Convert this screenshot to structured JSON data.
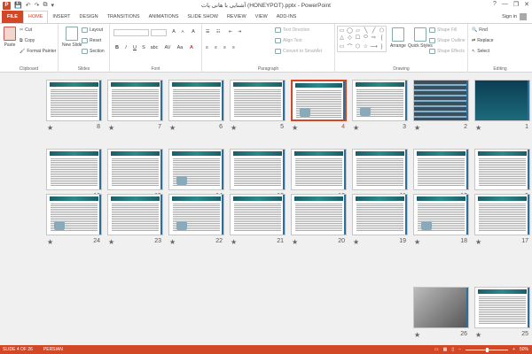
{
  "window": {
    "app_icon": "P",
    "title": "آشنایی با هانی پات (HONEYPOT).pptx - PowerPoint",
    "help": "?",
    "minimize": "—",
    "restore": "❐",
    "close": "✕"
  },
  "qat": {
    "save": "💾",
    "undo": "↶",
    "redo": "↷",
    "start": "⧉",
    "more": "▾"
  },
  "tabs": [
    "FILE",
    "HOME",
    "INSERT",
    "DESIGN",
    "TRANSITIONS",
    "ANIMATIONS",
    "SLIDE SHOW",
    "REVIEW",
    "VIEW",
    "ADD-INS"
  ],
  "active_tab": "HOME",
  "signin": "Sign in",
  "ribbon": {
    "clipboard": {
      "label": "Clipboard",
      "paste": "Paste",
      "cut": "Cut",
      "copy": "Copy",
      "format_painter": "Format Painter"
    },
    "slides": {
      "label": "Slides",
      "new_slide": "New Slide",
      "layout": "Layout",
      "reset": "Reset",
      "section": "Section"
    },
    "font": {
      "label": "Font",
      "size_value": "",
      "grow": "A",
      "shrink": "A",
      "clear": "A",
      "bold": "B",
      "italic": "I",
      "underline": "U",
      "strike": "S",
      "shadow": "abc",
      "spacing": "AV",
      "case": "Aa",
      "color": "A"
    },
    "paragraph": {
      "label": "Paragraph",
      "text_direction": "Text Direction",
      "align_text": "Align Text",
      "convert_smartart": "Convert to SmartArt"
    },
    "drawing": {
      "label": "Drawing",
      "arrange": "Arrange",
      "quick_styles": "Quick Styles",
      "shape_fill": "Shape Fill",
      "shape_outline": "Shape Outline",
      "shape_effects": "Shape Effects",
      "shapes": [
        "▭",
        "◯",
        "▱",
        "╲",
        "╱",
        "⬠",
        "△",
        "◇",
        "☐",
        "⬭",
        "⇨",
        "{",
        "▭",
        "⌒",
        "⬡",
        "☆",
        "⟶",
        "}"
      ]
    },
    "editing": {
      "label": "Editing",
      "find": "Find",
      "replace": "Replace",
      "select": "Select"
    }
  },
  "slides": [
    {
      "num": "1",
      "style": "title-slide"
    },
    {
      "num": "2",
      "style": "screens"
    },
    {
      "num": "3",
      "style": "text-pics"
    },
    {
      "num": "4",
      "style": "text-pics"
    },
    {
      "num": "5",
      "style": "text"
    },
    {
      "num": "6",
      "style": "text"
    },
    {
      "num": "7",
      "style": "text"
    },
    {
      "num": "8",
      "style": "text"
    },
    {
      "num": "9",
      "style": "text"
    },
    {
      "num": "10",
      "style": "text"
    },
    {
      "num": "11",
      "style": "text"
    },
    {
      "num": "12",
      "style": "text"
    },
    {
      "num": "13",
      "style": "text"
    },
    {
      "num": "14",
      "style": "text-pics"
    },
    {
      "num": "15",
      "style": "text"
    },
    {
      "num": "16",
      "style": "text"
    },
    {
      "num": "17",
      "style": "text"
    },
    {
      "num": "18",
      "style": "text-pics"
    },
    {
      "num": "19",
      "style": "text"
    },
    {
      "num": "20",
      "style": "text"
    },
    {
      "num": "21",
      "style": "text"
    },
    {
      "num": "22",
      "style": "text-pics"
    },
    {
      "num": "23",
      "style": "text"
    },
    {
      "num": "24",
      "style": "text-pics"
    },
    {
      "num": "25",
      "style": "text"
    },
    {
      "num": "26",
      "style": "photo"
    }
  ],
  "selected_slide": "4",
  "star": "★",
  "status": {
    "slide_info": "SLIDE 4 OF 26",
    "language": "PERSIAN",
    "zoom": "50%",
    "zoom_level": 0.5,
    "zoom_minus": "−",
    "zoom_plus": "+"
  },
  "colors": {
    "accent": "#d24726",
    "sorter_bg": "#f0f0f0",
    "slide_header": "#1b5e6a"
  }
}
